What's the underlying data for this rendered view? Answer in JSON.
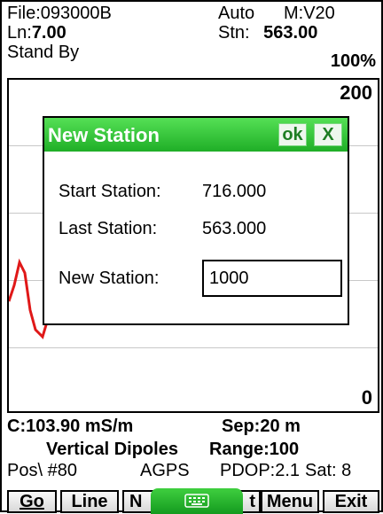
{
  "header": {
    "file": "File:093000B",
    "mode": "Auto",
    "meter": "M:V20",
    "line_label": "Ln:",
    "line_value": "7.00",
    "station_label": "Stn:",
    "station_value": "563.00",
    "state": "Stand By",
    "battery": "100%"
  },
  "plot": {
    "y_top": "200",
    "y_bottom": "0",
    "trace_color": "#e01818",
    "grid_color": "#c8c8c8"
  },
  "dialog": {
    "title": "New Station",
    "ok_label": "ok",
    "close_label": "X",
    "start_station_label": "Start Station:",
    "start_station_value": "716.000",
    "last_station_label": "Last  Station:",
    "last_station_value": "563.000",
    "new_station_label": "New  Station:",
    "new_station_value": "1000"
  },
  "status": {
    "conductivity": "C:103.90  mS/m",
    "separation": "Sep:20 m",
    "dipoles": "Vertical Dipoles",
    "range": "Range:100",
    "position": "Pos\\ #80",
    "gps": "AGPS",
    "pdop": "PDOP:2.1",
    "satellites": "Sat: 8"
  },
  "toolbar": {
    "go": "Go",
    "line": "Line",
    "n_partial": "N",
    "t_partial": "t",
    "menu": "Menu",
    "exit": "Exit",
    "keyboard_icon": "keyboard-icon",
    "accent": "#1fae27"
  }
}
